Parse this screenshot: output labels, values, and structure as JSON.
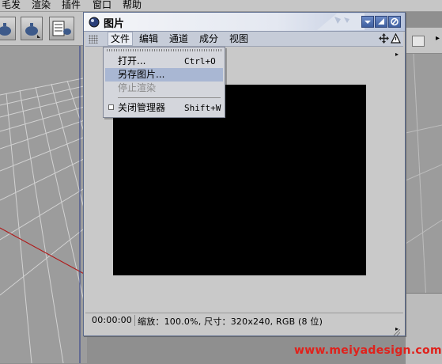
{
  "app": {
    "menu": [
      "毛发",
      "渲染",
      "插件",
      "窗口",
      "帮助"
    ]
  },
  "window": {
    "title": "图片",
    "menu": [
      "文件",
      "编辑",
      "通道",
      "成分",
      "视图"
    ],
    "status": {
      "time": "00:00:00",
      "info": "缩放：100.0%, 尺寸：320x240, RGB (8 位)"
    }
  },
  "dropdown": {
    "items": [
      {
        "label": "打开...",
        "shortcut": "Ctrl+O",
        "state": "normal"
      },
      {
        "label": "另存图片...",
        "shortcut": "",
        "state": "highlighted"
      },
      {
        "label": "停止渲染",
        "shortcut": "",
        "state": "disabled"
      },
      {
        "label": "关闭管理器",
        "shortcut": "Shift+W",
        "state": "checkbox"
      }
    ]
  },
  "watermark": "www.meiyadesign.com",
  "colors": {
    "accent_blue": "#4a66a8",
    "highlight": "#a9b7d3",
    "watermark": "#e0211b"
  }
}
